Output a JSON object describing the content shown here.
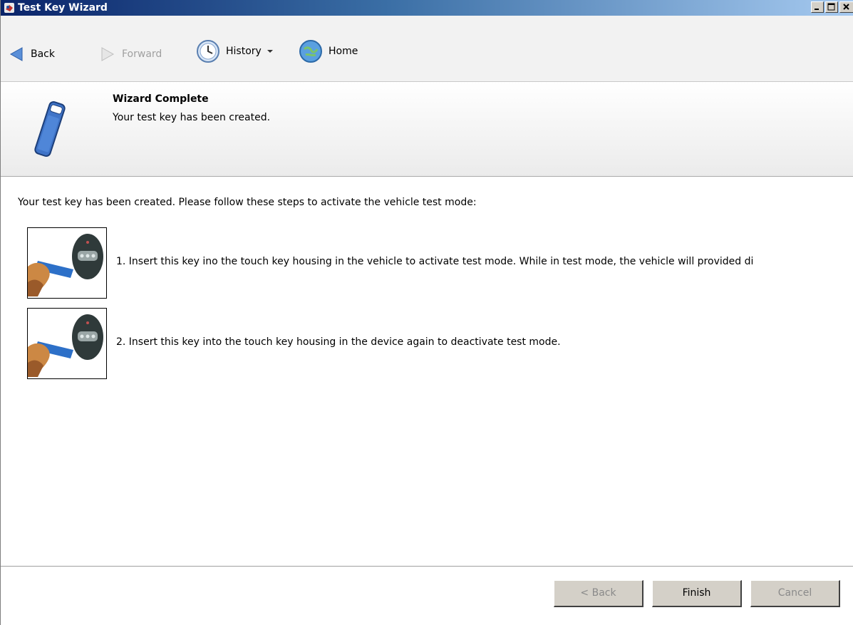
{
  "window": {
    "title": "Test Key Wizard"
  },
  "nav": {
    "back_label": "Back",
    "forward_label": "Forward",
    "history_label": "History",
    "home_label": "Home"
  },
  "header": {
    "title": "Wizard Complete",
    "subtitle": "Your test key has been created."
  },
  "content": {
    "intro": "Your test key has been created. Please follow these steps to activate the vehicle test mode:",
    "steps": [
      {
        "text": "1. Insert this key ino the touch key housing in the vehicle to activate test mode. While in test mode, the vehicle will provided di"
      },
      {
        "text": "2. Insert this key into the touch key housing in the device again to deactivate test mode."
      }
    ]
  },
  "footer": {
    "back_button": "< Back",
    "finish_button": "Finish",
    "cancel_button": "Cancel"
  },
  "colors": {
    "titlebar_start": "#0a246a",
    "titlebar_end": "#a6caf0",
    "button_face": "#d4d0c8"
  }
}
